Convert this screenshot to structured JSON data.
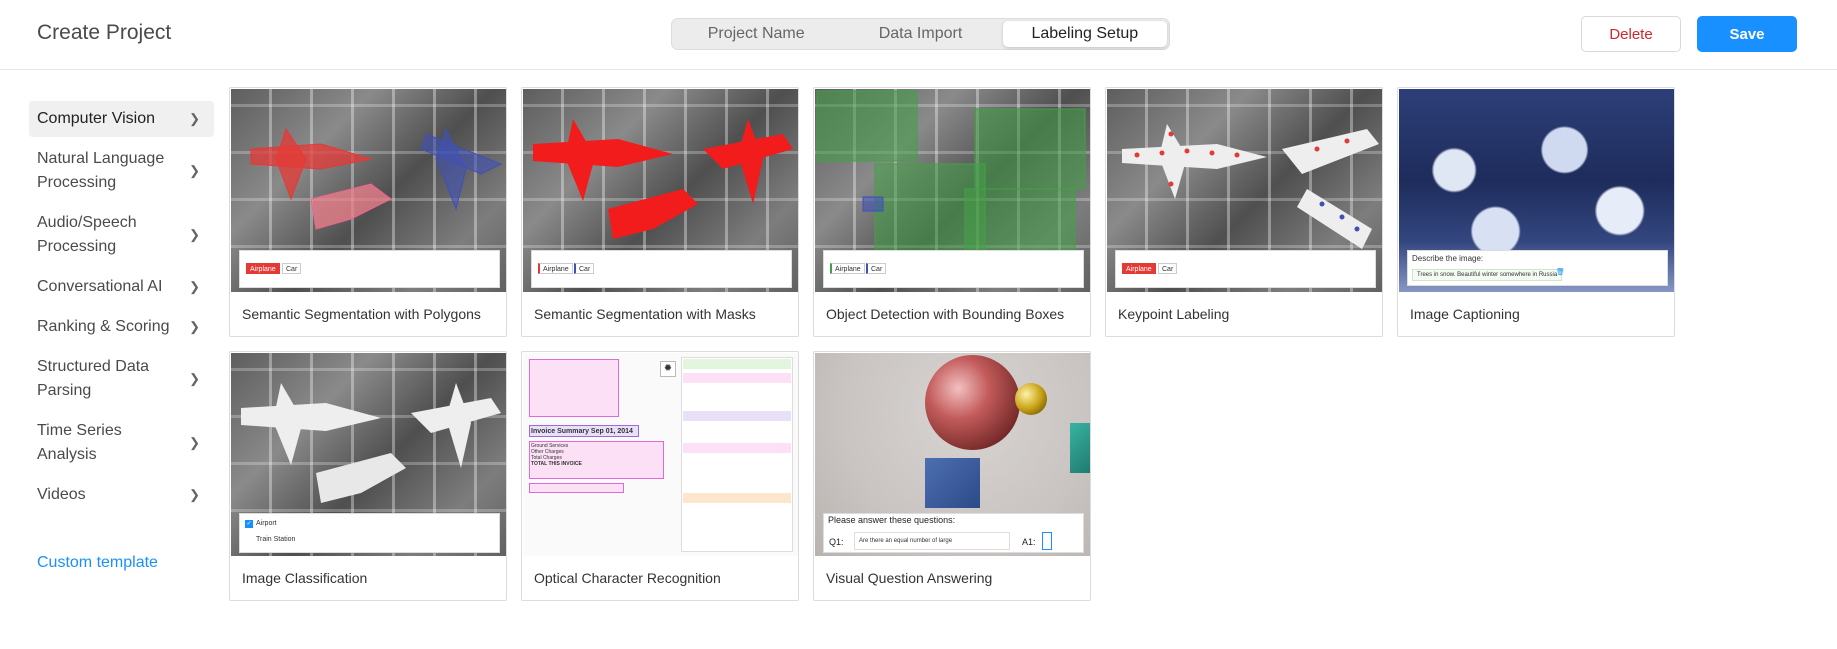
{
  "header": {
    "title": "Create Project",
    "tabs": [
      {
        "label": "Project Name",
        "active": false
      },
      {
        "label": "Data Import",
        "active": false
      },
      {
        "label": "Labeling Setup",
        "active": true
      }
    ],
    "delete_label": "Delete",
    "save_label": "Save"
  },
  "colors": {
    "accent": "#1890ff",
    "danger": "#d4252e"
  },
  "sidebar": {
    "items": [
      {
        "label": "Computer Vision",
        "active": true
      },
      {
        "label": "Natural Language Processing",
        "active": false
      },
      {
        "label": "Audio/Speech Processing",
        "active": false
      },
      {
        "label": "Conversational AI",
        "active": false
      },
      {
        "label": "Ranking & Scoring",
        "active": false
      },
      {
        "label": "Structured Data Parsing",
        "active": false
      },
      {
        "label": "Time Series Analysis",
        "active": false
      },
      {
        "label": "Videos",
        "active": false
      }
    ],
    "custom_template": "Custom template"
  },
  "templates": [
    {
      "title": "Semantic Segmentation with Polygons",
      "labels": [
        "Airplane",
        "Car"
      ]
    },
    {
      "title": "Semantic Segmentation with Masks",
      "labels": [
        "Airplane",
        "Car"
      ]
    },
    {
      "title": "Object Detection with Bounding Boxes",
      "labels": [
        "Airplane",
        "Car"
      ]
    },
    {
      "title": "Keypoint Labeling",
      "labels": [
        "Airplane",
        "Car"
      ]
    },
    {
      "title": "Image Captioning",
      "prompt": "Describe the image:",
      "caption": "Trees in snow. Beautiful winter somewhere in Russia"
    },
    {
      "title": "Image Classification",
      "labels": [
        "Airport",
        "Train Station"
      ]
    },
    {
      "title": "Optical Character Recognition",
      "ocr_text": [
        "Invoice Summary Sep 01, 2014",
        "Ground Services",
        "Other Charges",
        "Total Charges",
        "TOTAL THIS INVOICE"
      ]
    },
    {
      "title": "Visual Question Answering",
      "prompt": "Please answer these questions:",
      "q_label": "Q1:",
      "a_label": "A1:",
      "question": "Are there an equal number of large"
    }
  ]
}
